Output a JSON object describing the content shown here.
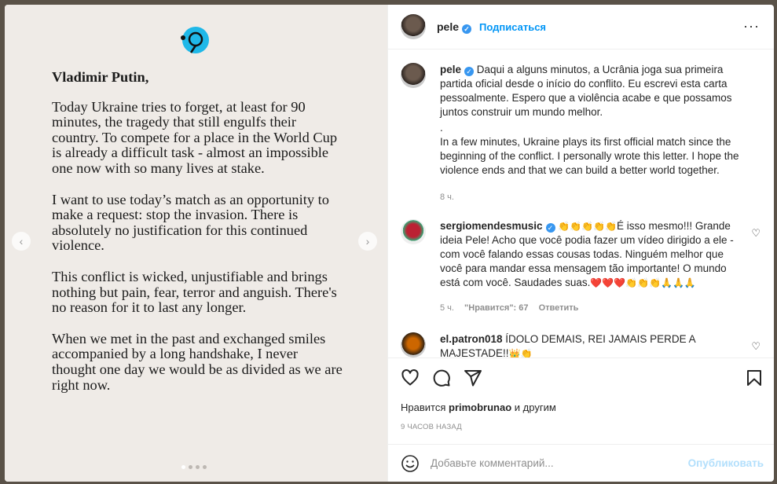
{
  "letter": {
    "greeting": "Vladimir Putin,",
    "paragraphs": [
      "Today Ukraine tries to forget, at least for 90 minutes, the tragedy that still engulfs their country. To compete for a place in the World Cup is already a difficult task - almost an impossible one now with so many lives at stake.",
      "I want to use today’s match as an opportunity to make a request: stop the invasion. There is absolutely no justification for this continued violence.",
      "This conflict is wicked, unjustifiable and brings nothing but pain, fear, terror and anguish. There's no reason for it to last any longer.",
      "When we met in the past and exchanged smiles accompanied by a long handshake, I never thought one day we would be as divided as we are right now."
    ],
    "prev_icon": "chevron-left-icon",
    "next_icon": "chevron-right-icon",
    "carousel_pages": 4,
    "carousel_active": 0
  },
  "header": {
    "username": "pele",
    "follow_label": "Подписаться",
    "more_label": "···"
  },
  "caption": {
    "username": "pele",
    "text_pt": "Daqui a alguns minutos, a Ucrânia joga sua primeira partida oficial desde o início do conflito. Eu escrevi esta carta pessoalmente. Espero que a violência acabe e que possamos juntos construir um mundo melhor.",
    "dot": ".",
    "text_en": "In a few minutes, Ukraine plays its first official match since the beginning of the conflict. I personally wrote this letter. I hope the violence ends and that we can build a better world together.",
    "time": "8 ч."
  },
  "comments": [
    {
      "username": "sergiomendesmusic",
      "emoji_prefix": "👏👏👏👏👏",
      "text": "É isso mesmo!!! Grande ideia Pele! Acho que você podia fazer um vídeo dirigido a ele - com você falando essas cousas todas. Ninguém melhor que você para mandar essa mensagem tão importante! O mundo está com você. Saudades suas.",
      "emoji_suffix": "❤️❤️❤️👏👏👏🙏🙏🙏",
      "time": "5 ч.",
      "likes": "\"Нравится\": 67",
      "reply": "Ответить"
    },
    {
      "username": "el.patron018",
      "text": "ÍDOLO DEMAIS, REI JAMAIS PERDE A MAJESTADE!!",
      "emoji_suffix": "👑👏"
    }
  ],
  "actions": {
    "liked_prefix": "Нравится",
    "liked_user": "primobrunao",
    "liked_suffix": "и другим",
    "time_ago": "9 ЧАСОВ НАЗАД"
  },
  "add_comment": {
    "placeholder": "Добавьте комментарий...",
    "publish_label": "Опубликовать"
  }
}
